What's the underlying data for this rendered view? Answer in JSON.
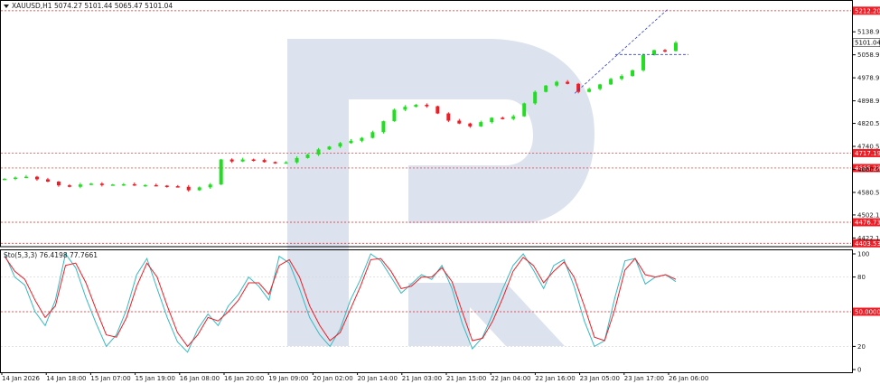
{
  "chart_data": [
    {
      "type": "candlestick",
      "title": "XAUUSD,H1",
      "ohlc_readout": "5074.27 5101.44 5065.47 5101.04",
      "last_price": 5101.04,
      "ylim": [
        4395,
        5240
      ],
      "price_ticks": [
        5138.9,
        5058.9,
        4978.9,
        4898.9,
        4820.5,
        4740.5,
        4660.5,
        4580.5,
        4502.1,
        4422.1
      ],
      "levels": [
        5212.2,
        4717.19,
        4665.28,
        4476.73,
        4403.53
      ],
      "level_labels": [
        "5212.20",
        "4717.19",
        "4665.28",
        "4476.73",
        "4403.53"
      ],
      "projection": {
        "from": 4925,
        "to": 5220
      },
      "horizontal_marker": 5060,
      "close_path": [
        4628,
        4632,
        4635,
        4626,
        4618,
        4605,
        4600,
        4608,
        4611,
        4606,
        4608,
        4609,
        4605,
        4606,
        4604,
        4602,
        4600,
        4588,
        4598,
        4608,
        4695,
        4688,
        4695,
        4693,
        4686,
        4685,
        4685,
        4700,
        4712,
        4730,
        4740,
        4752,
        4760,
        4770,
        4790,
        4828,
        4868,
        4878,
        4885,
        4880,
        4855,
        4830,
        4820,
        4810,
        4825,
        4840,
        4836,
        4845,
        4890,
        4930,
        4952,
        4965,
        4958,
        4930,
        4940,
        4956,
        4975,
        4985,
        5005,
        5058,
        5075,
        5072,
        5101
      ],
      "colors": {
        "up": "#22dd22",
        "down": "#ee1c25",
        "level": "#ee1c25",
        "level_tag": "#ee1c25",
        "last_tag": "#ffffff",
        "projection": "#3344cc",
        "grid": "#d8d8d8"
      }
    },
    {
      "type": "line",
      "title": "Sto(5,3,3) 76.4198 77.7661",
      "ylim": [
        0,
        100
      ],
      "ticks": [
        100,
        80,
        20,
        0
      ],
      "levels": [
        50
      ],
      "level_labels": [
        "50.0000"
      ],
      "series": [
        {
          "key": "k",
          "values": [
            100,
            80,
            73,
            50,
            38,
            60,
            100,
            88,
            62,
            40,
            20,
            30,
            52,
            82,
            96,
            70,
            45,
            24,
            15,
            35,
            48,
            38,
            55,
            65,
            80,
            72,
            60,
            98,
            92,
            70,
            45,
            30,
            20,
            35,
            60,
            78,
            100,
            94,
            80,
            66,
            74,
            82,
            78,
            90,
            70,
            40,
            18,
            28,
            48,
            70,
            90,
            100,
            86,
            70,
            90,
            95,
            72,
            42,
            20,
            25,
            62,
            94,
            96,
            74,
            80,
            82,
            76
          ],
          "color": "#35b9c4"
        },
        {
          "key": "d",
          "values": [
            98,
            85,
            78,
            60,
            45,
            55,
            90,
            92,
            75,
            52,
            30,
            28,
            45,
            72,
            92,
            80,
            55,
            32,
            20,
            30,
            45,
            42,
            50,
            60,
            75,
            75,
            65,
            90,
            95,
            80,
            55,
            38,
            25,
            32,
            52,
            72,
            95,
            96,
            85,
            70,
            72,
            80,
            80,
            88,
            76,
            50,
            25,
            27,
            42,
            62,
            85,
            97,
            90,
            75,
            85,
            93,
            80,
            55,
            28,
            25,
            52,
            86,
            96,
            82,
            80,
            82,
            78
          ],
          "color": "#ee1c25"
        }
      ]
    }
  ],
  "x_ticks": [
    "14 Jan 2026",
    "14 Jan 18:00",
    "15 Jan 07:00",
    "15 Jan 19:00",
    "16 Jan 08:00",
    "16 Jan 20:00",
    "19 Jan 09:00",
    "20 Jan 02:00",
    "20 Jan 14:00",
    "21 Jan 03:00",
    "21 Jan 15:00",
    "22 Jan 04:00",
    "22 Jan 16:00",
    "23 Jan 05:00",
    "23 Jan 17:00",
    "26 Jan 06:00"
  ],
  "icons": {
    "symbol_menu": "triangle-down-icon",
    "watermark": "r-logo-watermark"
  }
}
